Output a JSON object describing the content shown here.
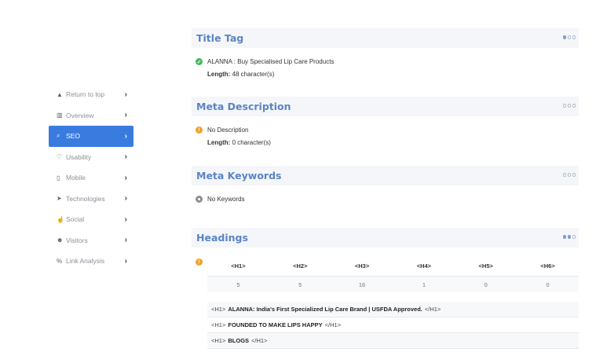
{
  "sidebar": {
    "items": [
      {
        "label": "Return to top",
        "icon": "chevron-up-icon",
        "glyph": "▲",
        "active": false
      },
      {
        "label": "Overview",
        "icon": "bar-chart-icon",
        "glyph": "▥",
        "active": false
      },
      {
        "label": "SEO",
        "icon": "search-icon",
        "glyph": "⌕",
        "active": true
      },
      {
        "label": "Usability",
        "icon": "lightbulb-icon",
        "glyph": "♡",
        "active": false
      },
      {
        "label": "Mobile",
        "icon": "mobile-icon",
        "glyph": "▯",
        "active": false
      },
      {
        "label": "Technologies",
        "icon": "paper-plane-icon",
        "glyph": "➤",
        "active": false
      },
      {
        "label": "Social",
        "icon": "thumbs-up-icon",
        "glyph": "☝",
        "active": false
      },
      {
        "label": "Visitors",
        "icon": "users-icon",
        "glyph": "☻",
        "active": false
      },
      {
        "label": "Link Analysis",
        "icon": "link-icon",
        "glyph": "%",
        "active": false
      }
    ],
    "chevron": "›"
  },
  "title_tag": {
    "title": "Title Tag",
    "value": "ALANNA : Buy Specialised Lip Care Products",
    "length_label": "Length:",
    "length_value": "48 character(s)",
    "status": "ok"
  },
  "meta_description": {
    "title": "Meta Description",
    "value": "No Description",
    "length_label": "Length:",
    "length_value": "0 character(s)",
    "status": "warning"
  },
  "meta_keywords": {
    "title": "Meta Keywords",
    "value": "No Keywords",
    "status": "neutral"
  },
  "headings": {
    "title": "Headings",
    "status": "warning",
    "columns": [
      "<H1>",
      "<H2>",
      "<H3>",
      "<H4>",
      "<H5>",
      "<H6>"
    ],
    "counts": [
      "5",
      "5",
      "16",
      "1",
      "0",
      "0"
    ],
    "list": [
      {
        "open": "<H1>",
        "text": "ALANNA: India's First Specialized Lip Care Brand | USFDA Approved.",
        "close": "</H1>"
      },
      {
        "open": "<H1>",
        "text": "FOUNDED TO MAKE LIPS HAPPY",
        "close": "</H1>"
      },
      {
        "open": "<H1>",
        "text": "BLOGS",
        "close": "</H1>"
      }
    ]
  },
  "colors": {
    "accent": "#3a7be0",
    "section_title": "#5b84c4",
    "ok": "#48b95a",
    "warning": "#f1a22a"
  }
}
